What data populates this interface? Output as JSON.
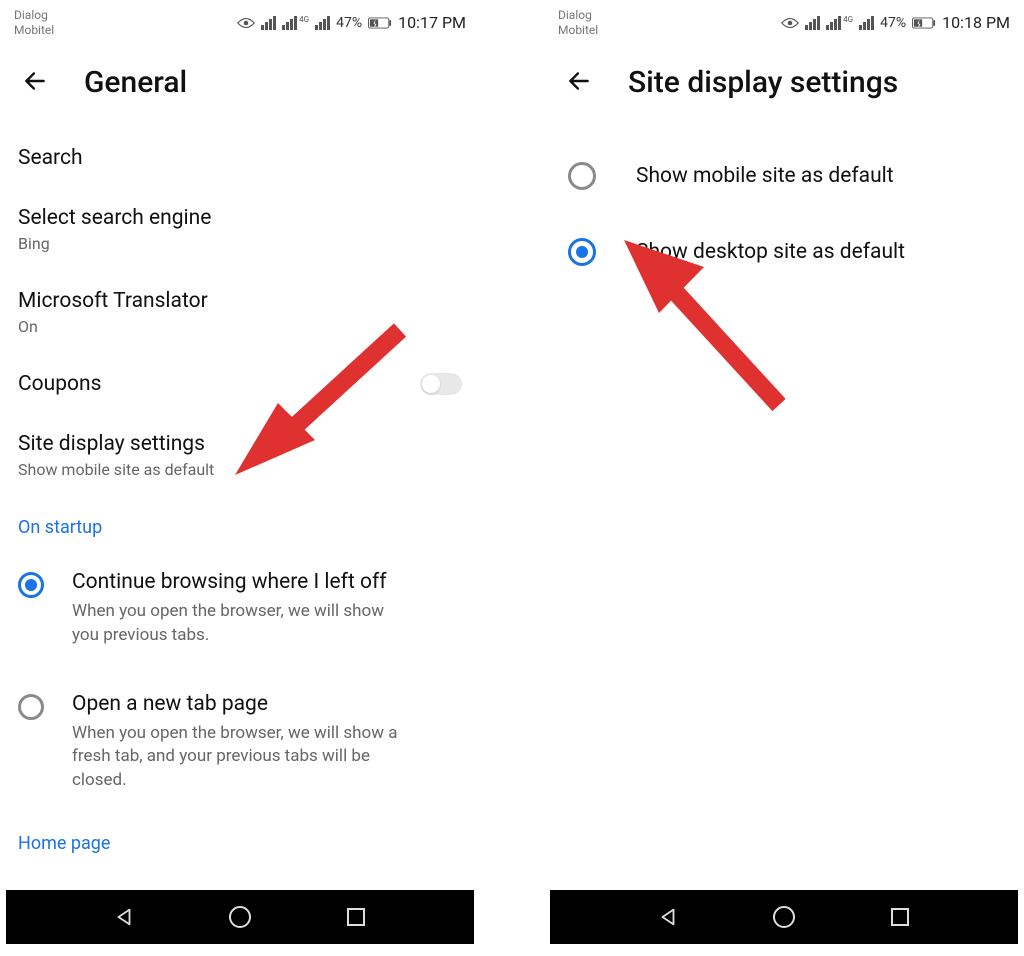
{
  "left": {
    "status": {
      "carriers": "Dialog\nMobitel",
      "battery": "47%",
      "time": "10:17 PM"
    },
    "title": "General",
    "search_label": "Search",
    "select_engine": {
      "title": "Select search engine",
      "value": "Bing"
    },
    "translator": {
      "title": "Microsoft Translator",
      "value": "On"
    },
    "coupons_label": "Coupons",
    "site_display": {
      "title": "Site display settings",
      "value": "Show mobile site as default"
    },
    "section_startup": "On startup",
    "startup_options": [
      {
        "title": "Continue browsing where I left off",
        "desc": "When you open the browser, we will show you previous tabs.",
        "selected": true
      },
      {
        "title": "Open a new tab page",
        "desc": "When you open the browser, we will show a fresh tab, and your previous tabs will be closed.",
        "selected": false
      }
    ],
    "homepage_label": "Home page"
  },
  "right": {
    "status": {
      "carriers": "Dialog\nMobitel",
      "battery": "47%",
      "time": "10:18 PM"
    },
    "title": "Site display settings",
    "options": [
      {
        "label": "Show mobile site as default",
        "selected": false
      },
      {
        "label": "Show desktop site as default",
        "selected": true
      }
    ]
  },
  "arrow_color": "#e03131"
}
